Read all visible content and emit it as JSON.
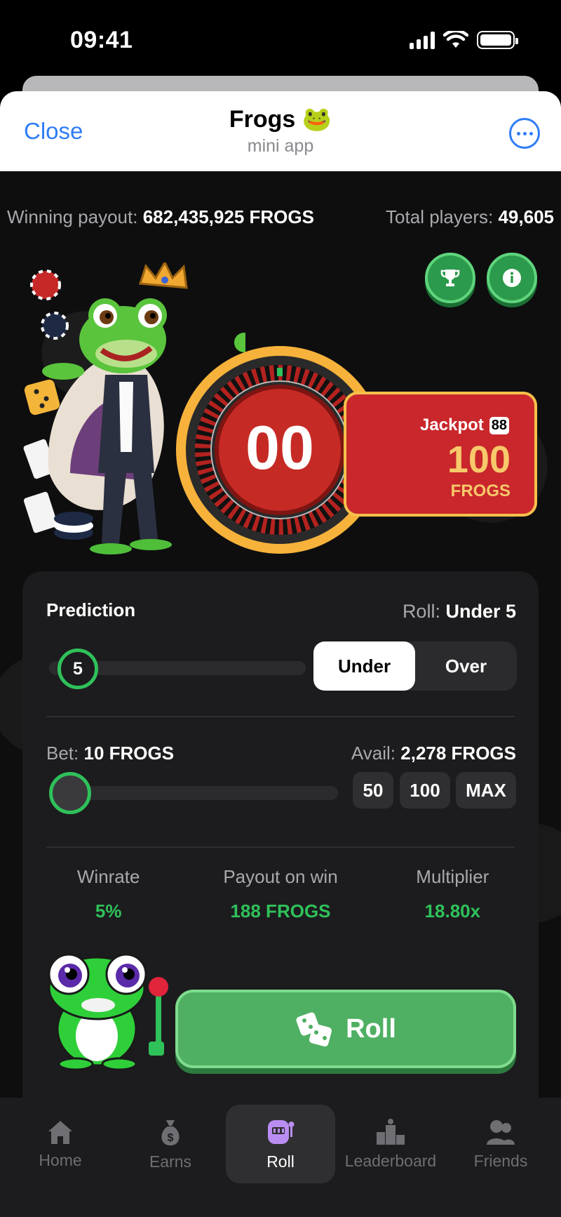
{
  "status_bar": {
    "time": "09:41"
  },
  "header": {
    "close_label": "Close",
    "title": "Frogs 🐸",
    "subtitle": "mini app"
  },
  "stats": {
    "winning_payout_label": "Winning payout:",
    "winning_payout_value": "682,435,925 FROGS",
    "total_players_label": "Total players:",
    "total_players_value": "49,605"
  },
  "roulette": {
    "number": "00"
  },
  "jackpot": {
    "label": "Jackpot",
    "badge": "88",
    "amount": "100",
    "unit": "FROGS"
  },
  "prediction": {
    "title": "Prediction",
    "roll_label": "Roll:",
    "roll_value": "Under 5",
    "slider_value": "5",
    "options": [
      "Under",
      "Over"
    ],
    "selected": "Under"
  },
  "bet": {
    "bet_label": "Bet:",
    "bet_value": "10 FROGS",
    "avail_label": "Avail:",
    "avail_value": "2,278 FROGS",
    "quick_amounts": [
      "50",
      "100",
      "MAX"
    ]
  },
  "metrics": [
    {
      "label": "Winrate",
      "value": "5%"
    },
    {
      "label": "Payout on win",
      "value": "188 FROGS"
    },
    {
      "label": "Multiplier",
      "value": "18.80x"
    }
  ],
  "roll_button": {
    "label": "Roll"
  },
  "tabs": [
    {
      "label": "Home",
      "icon": "home-icon"
    },
    {
      "label": "Earns",
      "icon": "money-bag-icon"
    },
    {
      "label": "Roll",
      "icon": "slot-machine-icon"
    },
    {
      "label": "Leaderboard",
      "icon": "podium-icon"
    },
    {
      "label": "Friends",
      "icon": "friends-icon"
    }
  ],
  "active_tab": "Roll",
  "colors": {
    "accent_green": "#2fc15a",
    "button_green": "#4faf63",
    "jackpot_red": "#c9272c",
    "link_blue": "#2f7cf6"
  }
}
